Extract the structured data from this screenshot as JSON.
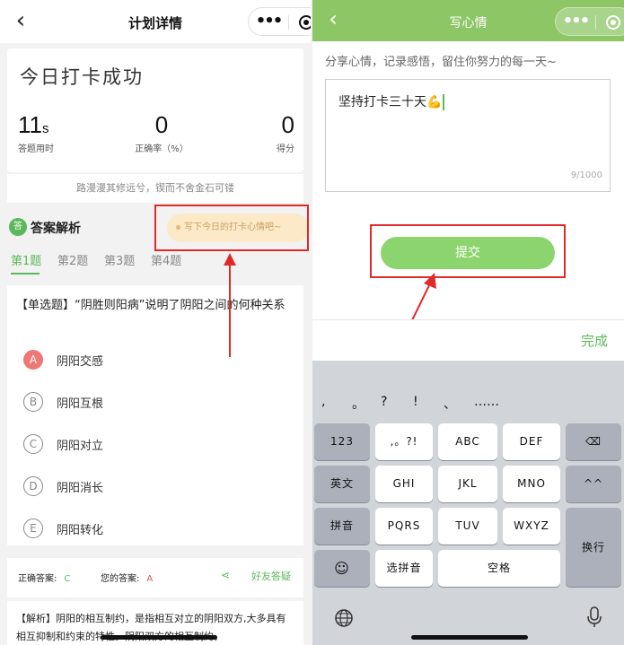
{
  "left": {
    "nav": {
      "back_icon": "chevron-left-icon",
      "title": "计划详情",
      "more_icon": "more-dots-icon",
      "record_icon": "target-icon"
    },
    "summary": {
      "title": "今日打卡成功",
      "stats": [
        {
          "value": "11",
          "unit": "s",
          "label": "答题用时"
        },
        {
          "value": "0",
          "unit": "",
          "label": "正确率（%）"
        },
        {
          "value": "0",
          "unit": "",
          "label": "得分"
        }
      ]
    },
    "motto": "路漫漫其修远兮，锲而不舍金石可镂",
    "analysis_header": {
      "icon_text": "答",
      "title": "答案解析"
    },
    "hint_button": "写下今日的打卡心情吧~",
    "tabs": [
      "第1题",
      "第2题",
      "第3题",
      "第4题"
    ],
    "question": {
      "text": "【单选题】“阴胜则阳病”说明了阴阳之间的何种关系",
      "options": [
        {
          "letter": "A",
          "text": "阴阳交感",
          "selected": true
        },
        {
          "letter": "B",
          "text": "阴阳互根",
          "selected": false
        },
        {
          "letter": "C",
          "text": "阴阳对立",
          "selected": false
        },
        {
          "letter": "D",
          "text": "阴阳消长",
          "selected": false
        },
        {
          "letter": "E",
          "text": "阴阳转化",
          "selected": false
        }
      ]
    },
    "answers": {
      "correct_label": "正确答案:",
      "correct_value": "C",
      "yours_label": "您的答案:",
      "yours_value": "A",
      "share_label": "好友答疑"
    },
    "explanation": "【解析】阴阳的相互制约，是指相互对立的阴阳双方,大多具有相互抑制和约束的特性。阴阳双方的相互制约，"
  },
  "right": {
    "nav": {
      "back_icon": "chevron-left-icon",
      "title": "写心情"
    },
    "prompt": "分享心情，记录感悟，留住你努力的每一天~",
    "input_value": "坚持打卡三十天💪",
    "char_count": "9/1000",
    "submit_label": "提交",
    "done_label": "完成",
    "keyboard": {
      "punct": [
        ",",
        "。",
        "?",
        "!",
        "、",
        "……"
      ],
      "rows": [
        [
          "123",
          ",。?!",
          "ABC",
          "DEF",
          "⌫"
        ],
        [
          "英文",
          "GHI",
          "JKL",
          "MNO",
          "^^"
        ],
        [
          "拼音",
          "PQRS",
          "TUV",
          "WXYZ",
          "换行"
        ],
        [
          "☺",
          "选拼音",
          "空格"
        ]
      ]
    }
  },
  "colors": {
    "accent": "#5cb85c",
    "header_green": "#8cc665",
    "annotation_red": "#e02a2a"
  }
}
